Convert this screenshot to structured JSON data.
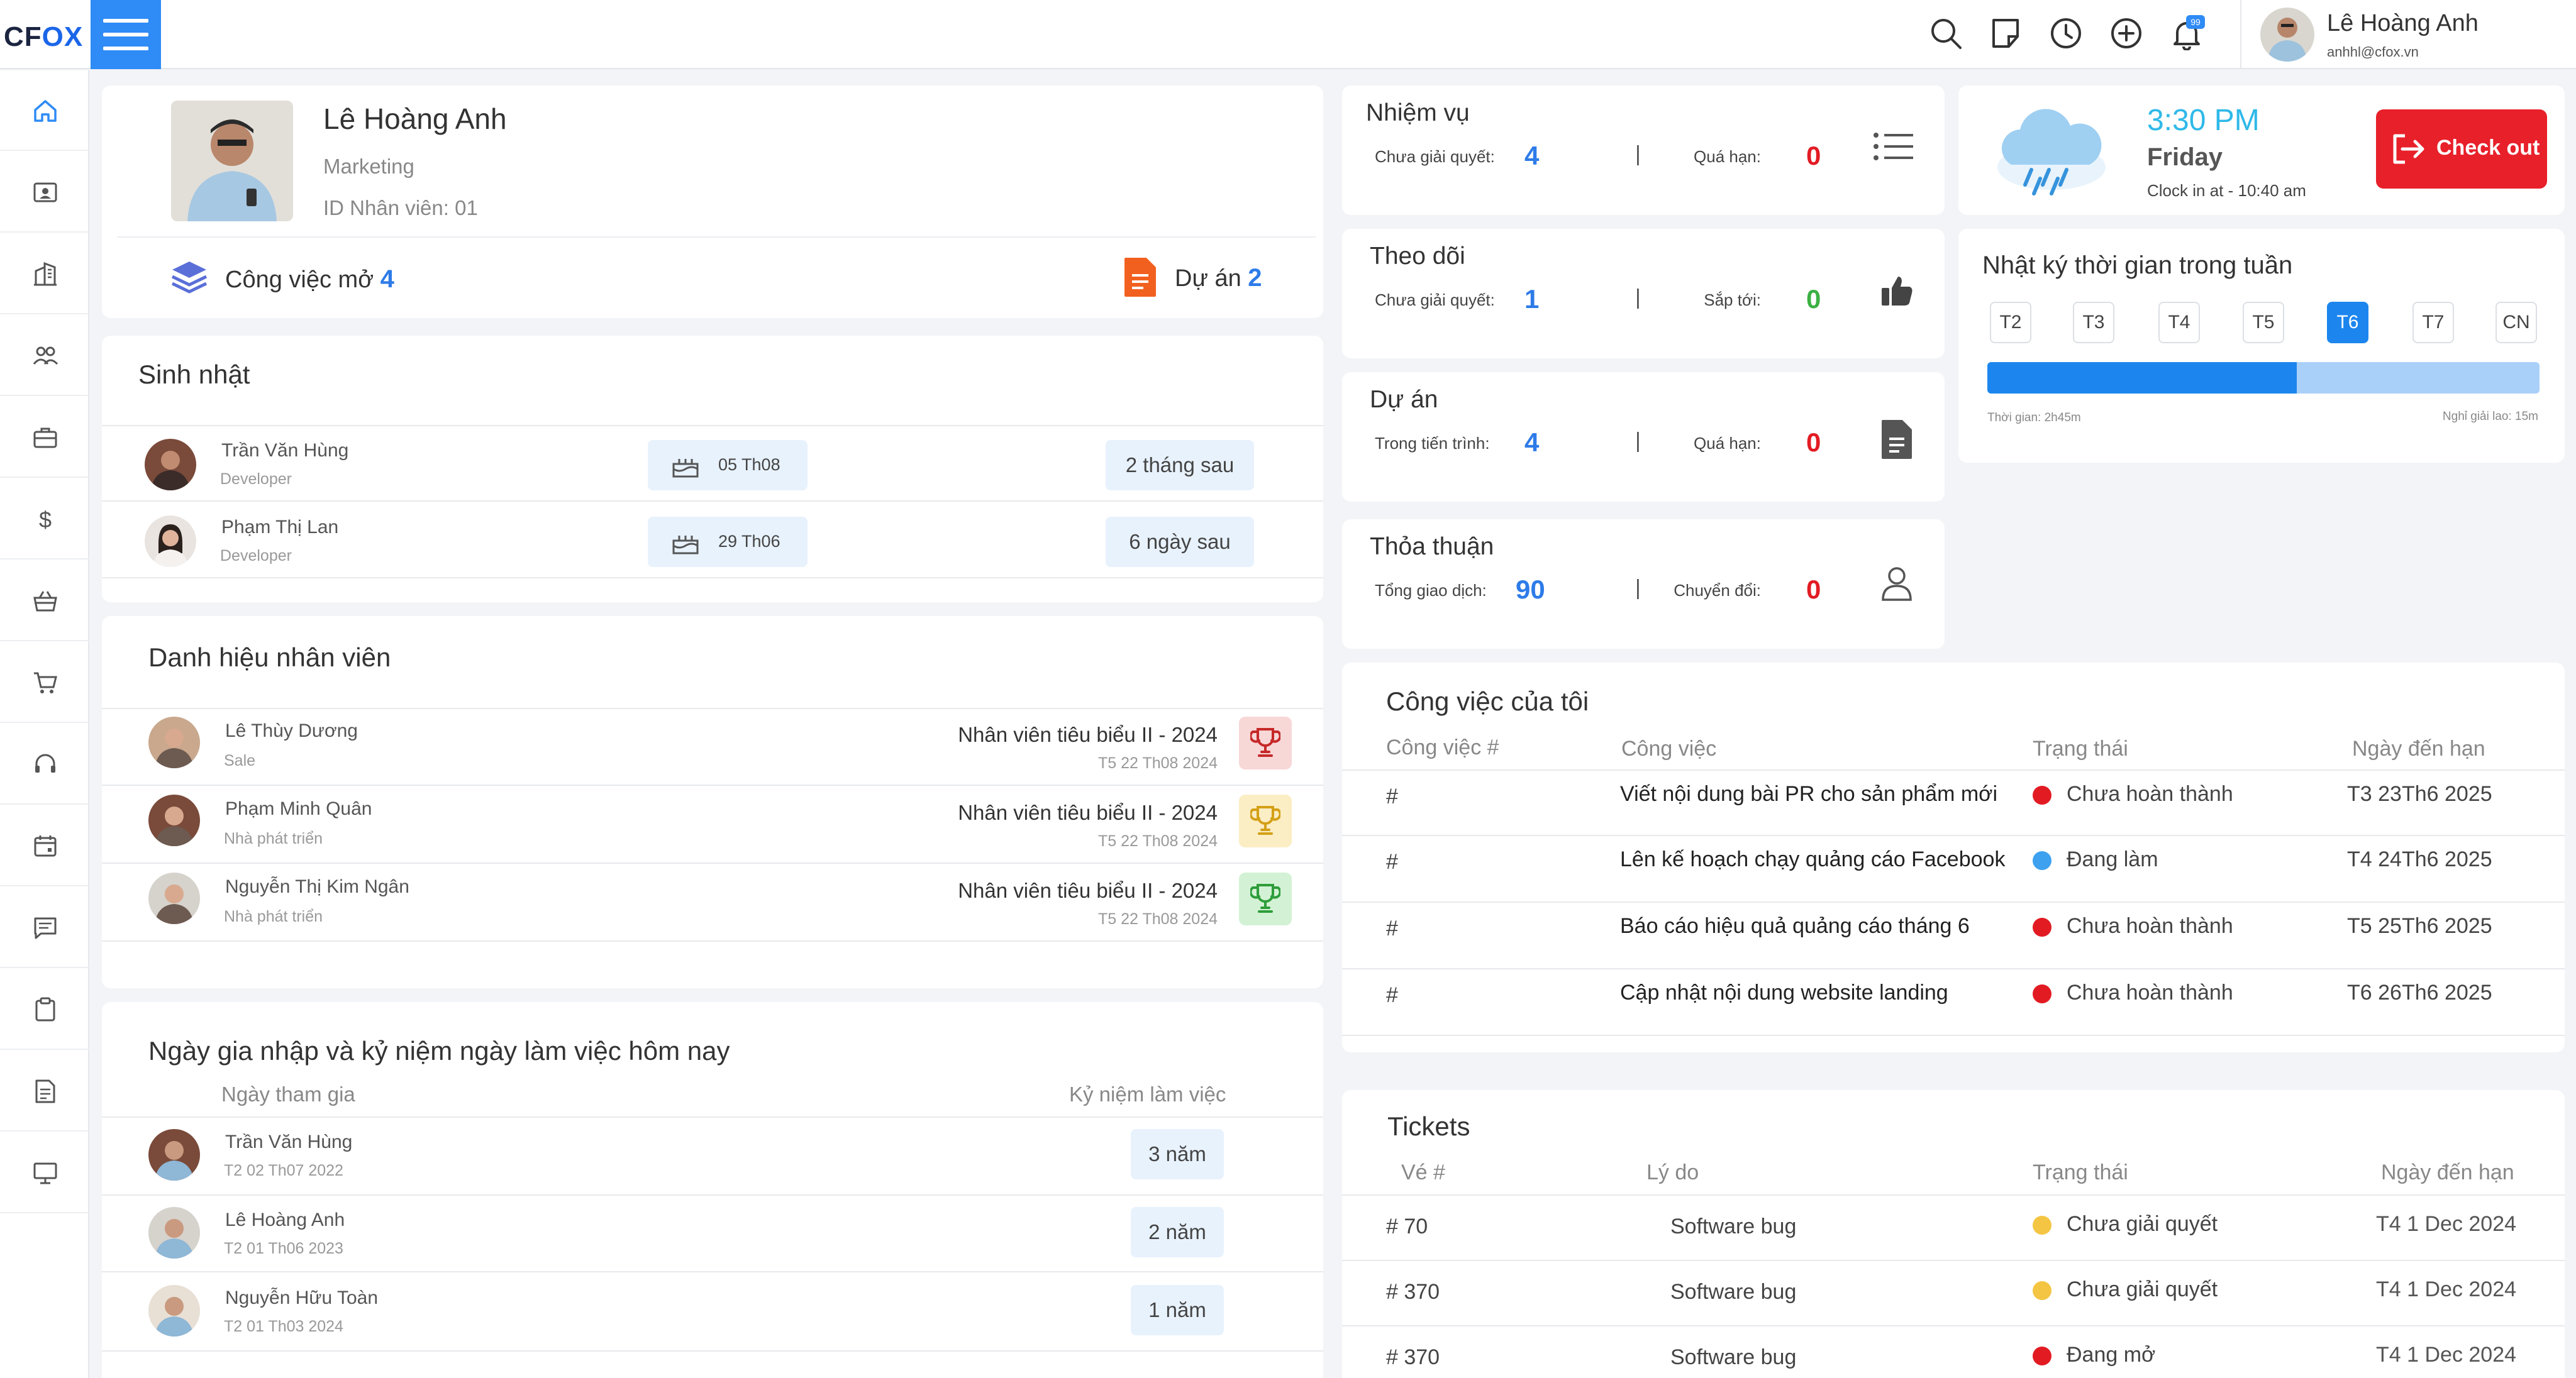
{
  "app": {
    "logo_prefix": "CF",
    "logo_x": "OX"
  },
  "header": {
    "user_name": "Lê Hoàng Anh",
    "user_email": "anhhl@cfox.vn",
    "notification_count": "99"
  },
  "profile": {
    "name": "Lê Hoàng Anh",
    "department": "Marketing",
    "employee_id": "ID Nhân viên: 01",
    "open_tasks_label": "Công việc mở",
    "open_tasks_count": "4",
    "projects_label": "Dự án",
    "projects_count": "2"
  },
  "birthdays": {
    "title": "Sinh nhật",
    "rows": [
      {
        "name": "Trần Văn Hùng",
        "role": "Developer",
        "date": "05 Th08",
        "when": "2 tháng sau"
      },
      {
        "name": "Phạm Thị Lan",
        "role": "Developer",
        "date": "29 Th06",
        "when": "6 ngày sau"
      }
    ]
  },
  "awards": {
    "title": "Danh hiệu nhân viên",
    "rows": [
      {
        "name": "Lê Thùy Dương",
        "role": "Sale",
        "award": "Nhân viên tiêu biểu II - 2024",
        "date": "T5 22 Th08 2024",
        "color": "#f8d7d7",
        "icon_color": "#c62828"
      },
      {
        "name": "Phạm Minh Quân",
        "role": "Nhà phát triển",
        "award": "Nhân viên tiêu biểu II - 2024",
        "date": "T5 22 Th08 2024",
        "color": "#fbedc4",
        "icon_color": "#d4a017"
      },
      {
        "name": "Nguyễn Thị Kim Ngân",
        "role": "Nhà phát triển",
        "award": "Nhân viên tiêu biểu II - 2024",
        "date": "T5 22 Th08 2024",
        "color": "#d3f2d5",
        "icon_color": "#2e9d3a"
      }
    ]
  },
  "anniversary": {
    "title": "Ngày gia nhập và kỷ niệm ngày làm việc hôm nay",
    "col_join": "Ngày tham gia",
    "col_years": "Kỷ niệm làm việc",
    "rows": [
      {
        "name": "Trần Văn Hùng",
        "date": "T2 02 Th07 2022",
        "years": "3 năm"
      },
      {
        "name": "Lê Hoàng Anh",
        "date": "T2 01 Th06 2023",
        "years": "2 năm"
      },
      {
        "name": "Nguyễn Hữu Toàn",
        "date": "T2 01 Th03 2024",
        "years": "1 năm"
      }
    ]
  },
  "stats": {
    "tasks": {
      "title": "Nhiệm vụ",
      "l1": "Chưa giải quyết:",
      "v1": "4",
      "l2": "Quá hạn:",
      "v2": "0",
      "icon": "list-icon"
    },
    "follow": {
      "title": "Theo dõi",
      "l1": "Chưa giải quyết:",
      "v1": "1",
      "l2": "Sắp tới:",
      "v2": "0",
      "icon": "thumbs-up-icon"
    },
    "projects": {
      "title": "Dự án",
      "l1": "Trong tiến trình:",
      "v1": "4",
      "l2": "Quá hạn:",
      "v2": "0",
      "icon": "document-icon"
    },
    "deals": {
      "title": "Thỏa thuận",
      "l1": "Tổng giao dịch:",
      "v1": "90",
      "l2": "Chuyển đổi:",
      "v2": "0",
      "icon": "person-icon"
    },
    "separator": "|"
  },
  "clock": {
    "time": "3:30 PM",
    "day": "Friday",
    "clock_in": "Clock in at - 10:40 am",
    "checkout_label": "Check out"
  },
  "timelog": {
    "title": "Nhật ký thời gian trong tuần",
    "days": [
      "T2",
      "T3",
      "T4",
      "T5",
      "T6",
      "T7",
      "CN"
    ],
    "active_day": "T6",
    "work_fraction": 0.56,
    "work_label": "Thời gian: 2h45m",
    "break_label": "Nghỉ giải lao: 15m"
  },
  "my_tasks": {
    "title": "Công việc của tôi",
    "headers": [
      "Công việc #",
      "Công việc",
      "Trạng thái",
      "Ngày đến hạn"
    ],
    "rows": [
      {
        "id": "#",
        "task": "Viết nội dung bài PR cho sản phẩm mới",
        "status": "Chưa hoàn thành",
        "status_color": "#e21b23",
        "due": "T3 23Th6 2025"
      },
      {
        "id": "#",
        "task": "Lên kế hoạch chạy quảng cáo Facebook",
        "status": "Đang làm",
        "status_color": "#3ea1f0",
        "due": "T4 24Th6 2025"
      },
      {
        "id": "#",
        "task": "Báo cáo hiệu quả quảng cáo tháng 6",
        "status": "Chưa hoàn thành",
        "status_color": "#e21b23",
        "due": "T5 25Th6 2025"
      },
      {
        "id": "#",
        "task": "Cập nhật nội dung website landing",
        "status": "Chưa hoàn thành",
        "status_color": "#e21b23",
        "due": "T6 26Th6 2025"
      }
    ]
  },
  "tickets": {
    "title": "Tickets",
    "headers": [
      "Vé #",
      "Lý do",
      "Trạng thái",
      "Ngày đến hạn"
    ],
    "rows": [
      {
        "id": "# 70",
        "reason": "Software bug",
        "status": "Chưa giải quyết",
        "status_color": "#f4c542",
        "due": "T4 1 Dec 2024"
      },
      {
        "id": "# 370",
        "reason": "Software bug",
        "status": "Chưa giải quyết",
        "status_color": "#f4c542",
        "due": "T4 1 Dec 2024"
      },
      {
        "id": "# 370",
        "reason": "Software bug",
        "status": "Đang mở",
        "status_color": "#e21b23",
        "due": "T4 1 Dec 2024"
      }
    ]
  },
  "colors": {
    "accent": "#2f8bf5",
    "checkout": "#e8202a",
    "number_blue": "#2d7be8",
    "number_red": "#e21b23",
    "number_green": "#3cb043"
  }
}
